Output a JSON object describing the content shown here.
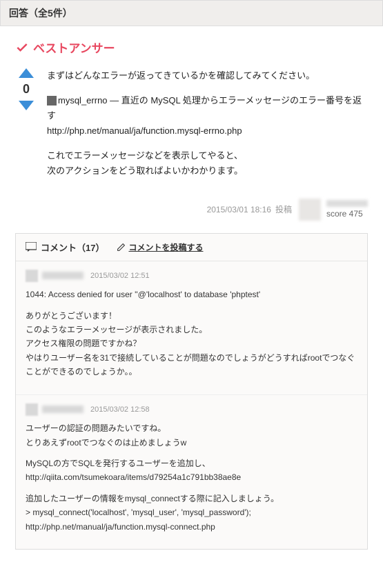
{
  "header": {
    "title": "回答（全5件）"
  },
  "best_answer_label": "ベストアンサー",
  "vote_score": "0",
  "answer": {
    "p1": "まずはどんなエラーが返ってきているかを確認してみてください。",
    "p2_label": "mysql_errno — 直近の MySQL 処理からエラーメッセージのエラー番号を返す",
    "p2_link": "http://php.net/manual/ja/function.mysql-errno.php",
    "p3_line1": "これでエラーメッセージなどを表示してやると、",
    "p3_line2": "次のアクションをどう取ればよいかわかります。"
  },
  "meta": {
    "datetime": "2015/03/01 18:16",
    "posted_label": "投稿",
    "score_label": "score 475"
  },
  "comments": {
    "header_label": "コメント（17）",
    "post_label": "コメントを投稿する",
    "items": [
      {
        "date": "2015/03/02 12:51",
        "p1": "1044: Access denied for user ''@'localhost' to database 'phptest'",
        "p2_l1": "ありがとうございます！",
        "p2_l2": "このようなエラーメッセージが表示されました。",
        "p2_l3": "アクセス権限の問題ですかね？",
        "p2_l4": "やはりユーザー名を31で接続していることが問題なのでしょうがどうすればrootでつなぐことができるのでしょうか。。"
      },
      {
        "date": "2015/03/02 12:58",
        "p1_l1": "ユーザーの認証の問題みたいですね。",
        "p1_l2": "とりあえずrootでつなぐのは止めましょうw",
        "p2_l1": "MySQLの方でSQLを発行するユーザーを追加し、",
        "p2_link": "http://qiita.com/tsumekoara/items/d79254a1c791bb38ae8e",
        "p3_l1": "追加したユーザーの情報をmysql_connectする際に記入しましょう。",
        "p3_l2": "> mysql_connect('localhost', 'mysql_user', 'mysql_password');",
        "p3_link": "http://php.net/manual/ja/function.mysql-connect.php"
      }
    ]
  }
}
